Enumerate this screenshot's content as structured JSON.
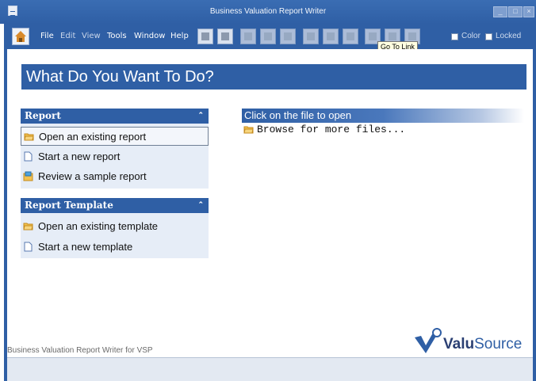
{
  "window": {
    "title": "Business Valuation Report Writer",
    "controls": [
      "_",
      "□",
      "×"
    ]
  },
  "toolbar": {
    "menus": [
      "File",
      "Edit",
      "View",
      "Tools",
      "Window",
      "Help"
    ],
    "buttons": [
      "save-icon",
      "print-icon",
      "copy-icon",
      "paste-icon",
      "format-icon",
      "insert-icon",
      "link-icon",
      "unlink-icon",
      "back-icon",
      "up-icon",
      "forward-icon"
    ],
    "color_label": "Color",
    "locked_label": "Locked",
    "tooltip": "Go To Link"
  },
  "header": {
    "title": "What Do You Want To Do?"
  },
  "report_panel": {
    "title": "Report",
    "items": [
      "Open an existing report",
      "Start a new report",
      "Review a sample report"
    ]
  },
  "template_panel": {
    "title": "Report Template",
    "items": [
      "Open an existing template",
      "Start a new template"
    ]
  },
  "open_section": {
    "title": "Click on the file to open",
    "browse": "Browse for more files..."
  },
  "footer": {
    "text": "Business Valuation Report Writer for VSP",
    "logo_bold": "Valu",
    "logo_light": "Source"
  },
  "colors": {
    "accent": "#2f5fa5",
    "panel_bg": "#e6edf7"
  }
}
